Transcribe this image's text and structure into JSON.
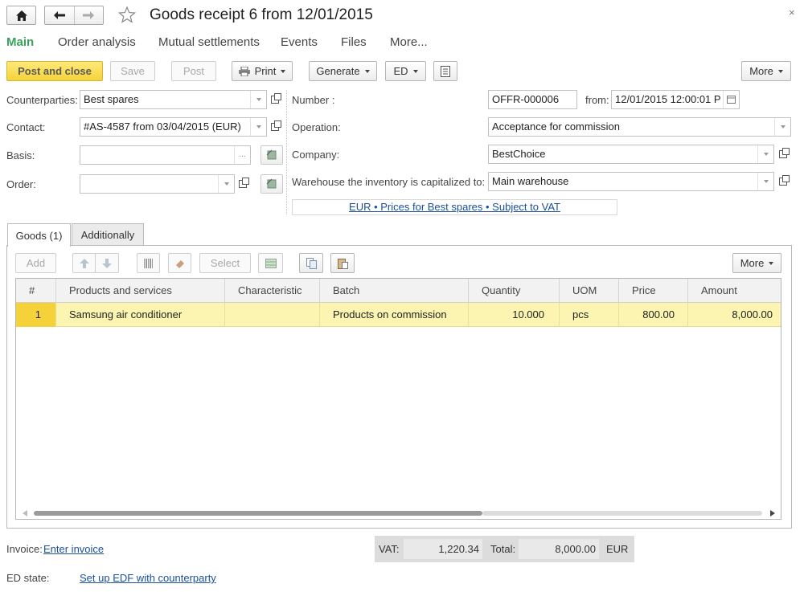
{
  "header": {
    "title": "Goods receipt 6 from 12/01/2015",
    "close_glyph": "×",
    "icons": [
      "home-icon",
      "back-arrow-icon",
      "forward-arrow-icon",
      "star-icon"
    ]
  },
  "nav": {
    "items": [
      "Main",
      "Order analysis",
      "Mutual settlements",
      "Events",
      "Files",
      "More..."
    ]
  },
  "toolbar": {
    "post_and_close": "Post and close",
    "save": "Save",
    "post": "Post",
    "print": "Print",
    "generate": "Generate",
    "ed": "ED",
    "more": "More"
  },
  "form": {
    "counterparties_label": "Counterparties:",
    "counterparties_value": "Best spares",
    "contact_label": "Contact:",
    "contact_value": "#AS-4587 from 03/04/2015 (EUR)",
    "basis_label": "Basis:",
    "basis_value": "",
    "basis_ellipsis": "...",
    "order_label": "Order:",
    "order_value": "",
    "number_label": "Number :",
    "number_value": "OFFR-000006",
    "from_label": "from:",
    "from_value": "12/01/2015 12:00:01 P",
    "operation_label": "Operation:",
    "operation_value": "Acceptance for commission",
    "company_label": "Company:",
    "company_value": "BestChoice",
    "warehouse_label": "Warehouse the inventory is capitalized to:",
    "warehouse_value": "Main warehouse",
    "prices_link": "EUR • Prices for Best spares • Subject to VAT"
  },
  "tabs": [
    "Goods (1)",
    "Additionally"
  ],
  "goods_toolbar": {
    "add": "Add",
    "select": "Select",
    "more": "More"
  },
  "table": {
    "columns": [
      "#",
      "Products and services",
      "Characteristic",
      "Batch",
      "Quantity",
      "UOM",
      "Price",
      "Amount"
    ],
    "rows": [
      {
        "n": "1",
        "product": "Samsung air conditioner",
        "characteristic": "",
        "batch": "Products on commission",
        "quantity": "10.000",
        "uom": "pcs",
        "price": "800.00",
        "amount": "8,000.00"
      }
    ]
  },
  "footer": {
    "invoice_label": "Invoice:",
    "invoice_link": "Enter invoice",
    "ed_state_label": "ED state:",
    "ed_state_link": "Set up EDF with counterparty",
    "vat_label": "VAT:",
    "vat_value": "1,220.34",
    "total_label": "Total:",
    "total_value": "8,000.00",
    "currency": "EUR"
  },
  "colors": {
    "accent_active_nav": "#3aa05a",
    "primary_button": "#f5d33a",
    "selected_row": "#fcf5b2",
    "link": "#1a4f9c"
  }
}
